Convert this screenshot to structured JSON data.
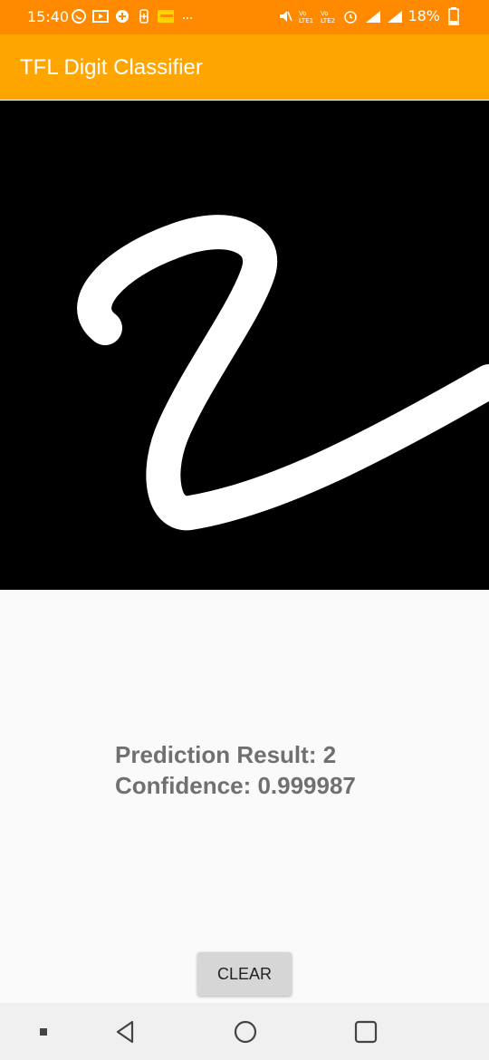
{
  "status_bar": {
    "time": "15:40",
    "battery_percent": "18%",
    "icons_left": [
      "whatsapp-icon",
      "youtube-icon",
      "app-icon",
      "battery-saver-icon",
      "notification-icon",
      "more-icon"
    ],
    "icons_right": [
      "mute-icon",
      "volte1-icon",
      "volte2-icon",
      "alarm-icon",
      "signal1-icon",
      "signal2-icon",
      "battery-icon"
    ]
  },
  "app_bar": {
    "title": "TFL Digit Classifier",
    "color": "#ffa500"
  },
  "canvas": {
    "background": "#000000",
    "stroke_color": "#ffffff"
  },
  "result": {
    "prediction_text": "Prediction Result: 2",
    "confidence_text": "Confidence: 0.999987"
  },
  "actions": {
    "clear_label": "CLEAR"
  },
  "nav_bar": {
    "items": [
      "recent-apps-icon",
      "back-icon",
      "home-icon",
      "overview-icon"
    ]
  }
}
